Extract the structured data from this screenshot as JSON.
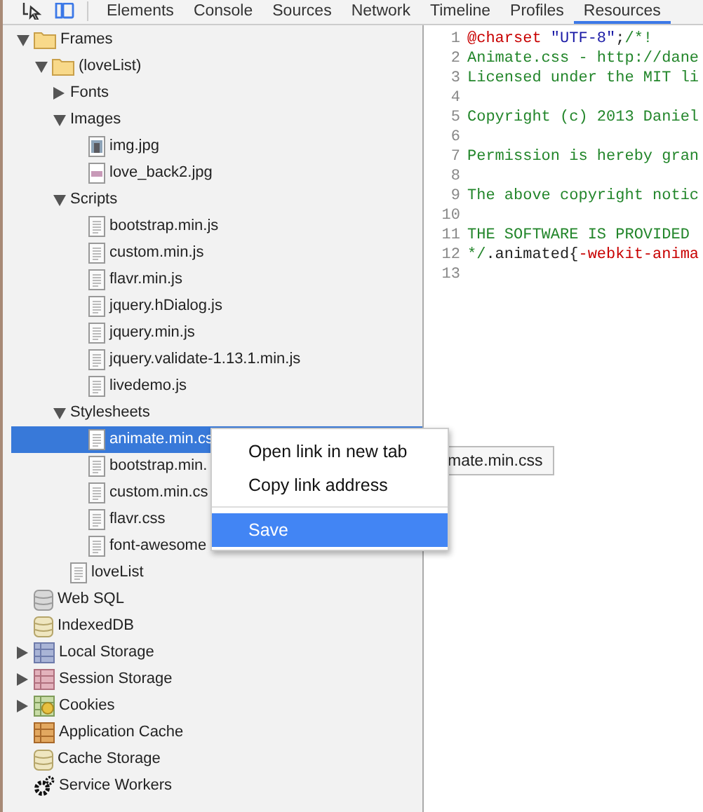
{
  "toolbar": {
    "tabs": [
      {
        "label": "Elements",
        "selected": false
      },
      {
        "label": "Console",
        "selected": false
      },
      {
        "label": "Sources",
        "selected": false
      },
      {
        "label": "Network",
        "selected": false
      },
      {
        "label": "Timeline",
        "selected": false
      },
      {
        "label": "Profiles",
        "selected": false
      },
      {
        "label": "Resources",
        "selected": true
      }
    ]
  },
  "tree": [
    {
      "label": "Frames",
      "kind": "folder",
      "expanded": true,
      "selected": false,
      "children": [
        {
          "label": "(loveList)",
          "kind": "folder",
          "expanded": true,
          "selected": false,
          "children": [
            {
              "label": "Fonts",
              "kind": "group",
              "expanded": false,
              "selected": false
            },
            {
              "label": "Images",
              "kind": "group",
              "expanded": true,
              "selected": false,
              "children": [
                {
                  "label": "img.jpg",
                  "kind": "photo",
                  "selected": false
                },
                {
                  "label": "love_back2.jpg",
                  "kind": "image",
                  "selected": false
                }
              ]
            },
            {
              "label": "Scripts",
              "kind": "group",
              "expanded": true,
              "selected": false,
              "children": [
                {
                  "label": "bootstrap.min.js",
                  "kind": "file",
                  "selected": false
                },
                {
                  "label": "custom.min.js",
                  "kind": "file",
                  "selected": false
                },
                {
                  "label": "flavr.min.js",
                  "kind": "file",
                  "selected": false
                },
                {
                  "label": "jquery.hDialog.js",
                  "kind": "file",
                  "selected": false
                },
                {
                  "label": "jquery.min.js",
                  "kind": "file",
                  "selected": false
                },
                {
                  "label": "jquery.validate-1.13.1.min.js",
                  "kind": "file",
                  "selected": false
                },
                {
                  "label": "livedemo.js",
                  "kind": "file",
                  "selected": false
                }
              ]
            },
            {
              "label": "Stylesheets",
              "kind": "group",
              "expanded": true,
              "selected": false,
              "children": [
                {
                  "label": "animate.min.cs",
                  "kind": "file",
                  "selected": true
                },
                {
                  "label": "bootstrap.min.",
                  "kind": "file",
                  "selected": false
                },
                {
                  "label": "custom.min.cs",
                  "kind": "file",
                  "selected": false
                },
                {
                  "label": "flavr.css",
                  "kind": "file",
                  "selected": false
                },
                {
                  "label": "font-awesome",
                  "kind": "file",
                  "selected": false
                }
              ]
            },
            {
              "label": "loveList",
              "kind": "file",
              "selected": false
            }
          ]
        }
      ]
    },
    {
      "label": "Web SQL",
      "kind": "db-grey",
      "selected": false
    },
    {
      "label": "IndexedDB",
      "kind": "db-gold",
      "selected": false
    },
    {
      "label": "Local Storage",
      "kind": "grid-blue",
      "expanded": false,
      "selected": false
    },
    {
      "label": "Session Storage",
      "kind": "grid-pink",
      "expanded": false,
      "selected": false
    },
    {
      "label": "Cookies",
      "kind": "cookies",
      "expanded": false,
      "selected": false
    },
    {
      "label": "Application Cache",
      "kind": "grid-orange",
      "selected": false
    },
    {
      "label": "Cache Storage",
      "kind": "db-gold",
      "selected": false
    },
    {
      "label": "Service Workers",
      "kind": "gear",
      "selected": false
    }
  ],
  "code": {
    "lines": [
      {
        "number": "1",
        "parts": [
          {
            "text": "@charset",
            "kind": "at"
          },
          {
            "text": " \"UTF-8\"",
            "kind": "string"
          },
          {
            "text": ";",
            "kind": "plain"
          },
          {
            "text": "/*!",
            "kind": "comment"
          }
        ]
      },
      {
        "number": "2",
        "parts": [
          {
            "text": "Animate.css - http://dane",
            "kind": "comment"
          }
        ]
      },
      {
        "number": "3",
        "parts": [
          {
            "text": "Licensed under the MIT li",
            "kind": "comment"
          }
        ]
      },
      {
        "number": "4"
      },
      {
        "number": "5",
        "parts": [
          {
            "text": "Copyright (c) 2013 Daniel",
            "kind": "comment"
          }
        ]
      },
      {
        "number": "6"
      },
      {
        "number": "7",
        "parts": [
          {
            "text": "Permission is hereby gran",
            "kind": "comment"
          }
        ]
      },
      {
        "number": "8"
      },
      {
        "number": "9",
        "parts": [
          {
            "text": "The above copyright notic",
            "kind": "comment"
          }
        ]
      },
      {
        "number": "10"
      },
      {
        "number": "11",
        "parts": [
          {
            "text": "THE SOFTWARE IS PROVIDED",
            "kind": "comment"
          }
        ]
      },
      {
        "number": "12",
        "parts": [
          {
            "text": "*/",
            "kind": "comment"
          },
          {
            "text": ".animated{",
            "kind": "plain"
          },
          {
            "text": "-webkit-anima",
            "kind": "at"
          }
        ]
      },
      {
        "number": "13"
      }
    ]
  },
  "tooltip": "mate.min.css",
  "context_menu": [
    {
      "kind": "item",
      "label": "Open link in new tab",
      "selected": false
    },
    {
      "kind": "item",
      "label": "Copy link address",
      "selected": false
    },
    {
      "kind": "separator"
    },
    {
      "kind": "item",
      "label": "Save",
      "selected": true
    }
  ]
}
